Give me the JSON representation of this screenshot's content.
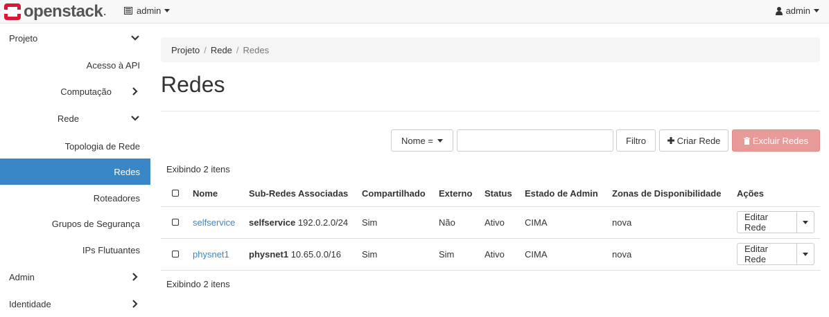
{
  "topbar": {
    "logo_text": "openstack",
    "project_selector": "admin",
    "user_menu": "admin"
  },
  "sidebar": {
    "items": [
      {
        "label": "Projeto"
      },
      {
        "label": "Acesso à API"
      },
      {
        "label": "Computação"
      },
      {
        "label": "Rede"
      },
      {
        "label": "Topologia de Rede"
      },
      {
        "label": "Redes"
      },
      {
        "label": "Roteadores"
      },
      {
        "label": "Grupos de Segurança"
      },
      {
        "label": "IPs Flutuantes"
      },
      {
        "label": "Admin"
      },
      {
        "label": "Identidade"
      }
    ]
  },
  "breadcrumb": {
    "items": [
      "Projeto",
      "Rede",
      "Redes"
    ]
  },
  "page": {
    "title": "Redes"
  },
  "toolbar": {
    "filter_select": "Nome =",
    "filter_value": "",
    "filter_button": "Filtro",
    "create_button": "Criar Rede",
    "delete_button": "Excluir Redes"
  },
  "table": {
    "count_top": "Exibindo 2 itens",
    "count_bottom": "Exibindo 2 itens",
    "headers": [
      "Nome",
      "Sub-Redes Associadas",
      "Compartilhado",
      "Externo",
      "Status",
      "Estado de Admin",
      "Zonas de Disponibilidade",
      "Ações"
    ],
    "rows": [
      {
        "name": "selfservice",
        "subnet_name": "selfservice",
        "subnet_cidr": "192.0.2.0/24",
        "shared": "Sim",
        "external": "Não",
        "status": "Ativo",
        "admin_state": "CIMA",
        "zones": "nova",
        "action": "Editar Rede"
      },
      {
        "name": "physnet1",
        "subnet_name": "physnet1",
        "subnet_cidr": "10.65.0.0/16",
        "shared": "Sim",
        "external": "Sim",
        "status": "Ativo",
        "admin_state": "CIMA",
        "zones": "nova",
        "action": "Editar Rede"
      }
    ]
  },
  "colors": {
    "accent": "#3a87c8",
    "danger": "#e89a98",
    "brand": "#da1a32"
  }
}
